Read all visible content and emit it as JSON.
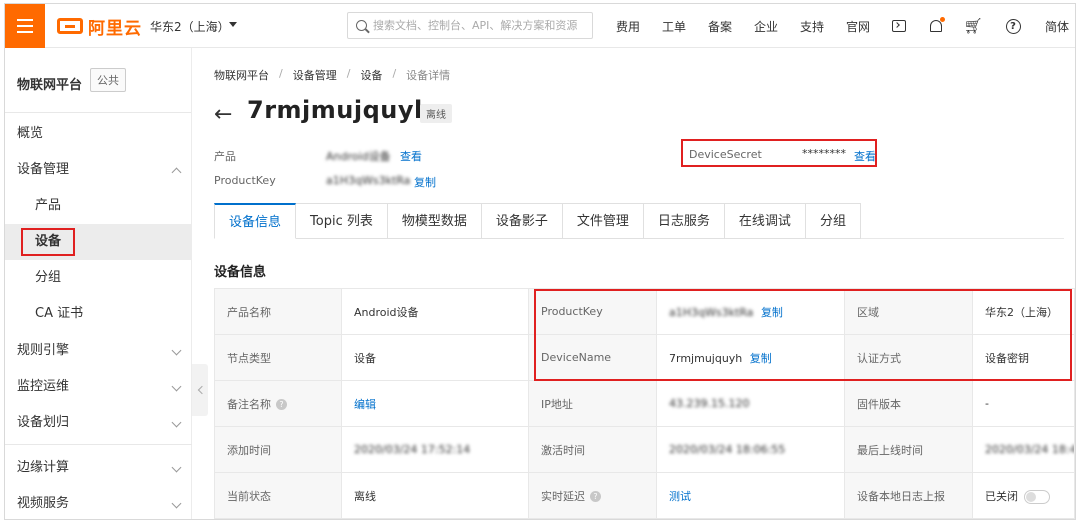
{
  "topbar": {
    "logo_text": "阿里云",
    "region": "华东2（上海）",
    "search_placeholder": "搜索文档、控制台、API、解决方案和资源",
    "nav": [
      "费用",
      "工单",
      "备案",
      "企业",
      "支持",
      "官网"
    ],
    "lang": "简体",
    "accent": "#ff6a00"
  },
  "sidebar": {
    "title": "物联网平台",
    "badge": "公共",
    "items": [
      {
        "label": "概览"
      },
      {
        "label": "设备管理"
      },
      {
        "label": "产品"
      },
      {
        "label": "设备"
      },
      {
        "label": "分组"
      },
      {
        "label": "CA 证书"
      },
      {
        "label": "规则引擎"
      },
      {
        "label": "监控运维"
      },
      {
        "label": "设备划归"
      },
      {
        "label": "边缘计算"
      },
      {
        "label": "视频服务"
      }
    ]
  },
  "breadcrumb": [
    "物联网平台",
    "设备管理",
    "设备",
    "设备详情"
  ],
  "device": {
    "back": "←",
    "name": "7rmjmujquyh",
    "status": "离线",
    "product_label": "产品",
    "product_value": "Android设备",
    "view_label": "查看",
    "productkey_label": "ProductKey",
    "productkey_value": "a1H3qWs3ktRa",
    "copy_label": "复制",
    "secret_label": "DeviceSecret",
    "secret_value": "********",
    "secret_view": "查看"
  },
  "tabs": [
    "设备信息",
    "Topic 列表",
    "物模型数据",
    "设备影子",
    "文件管理",
    "日志服务",
    "在线调试",
    "分组"
  ],
  "section_title": "设备信息",
  "table": {
    "rows": [
      [
        {
          "k": "产品名称",
          "v": "Android设备"
        },
        {
          "k": "ProductKey",
          "v": "a1H3qWs3ktRa",
          "action": "复制"
        },
        {
          "k": "区域",
          "v": "华东2（上海）"
        }
      ],
      [
        {
          "k": "节点类型",
          "v": "设备"
        },
        {
          "k": "DeviceName",
          "v": "7rmjmujquyh",
          "action": "复制"
        },
        {
          "k": "认证方式",
          "v": "设备密钥"
        }
      ],
      [
        {
          "k": "备注名称",
          "v": "编辑"
        },
        {
          "k": "IP地址",
          "v": "43.239.15.120"
        },
        {
          "k": "固件版本",
          "v": "-"
        }
      ],
      [
        {
          "k": "添加时间",
          "v": "2020/03/24 17:52:14"
        },
        {
          "k": "激活时间",
          "v": "2020/03/24 18:06:55"
        },
        {
          "k": "最后上线时间",
          "v": "2020/03/24 18:47"
        }
      ],
      [
        {
          "k": "当前状态",
          "v": "离线"
        },
        {
          "k": "实时延迟",
          "v": "测试"
        },
        {
          "k": "设备本地日志上报",
          "v": "已关闭"
        }
      ]
    ]
  }
}
